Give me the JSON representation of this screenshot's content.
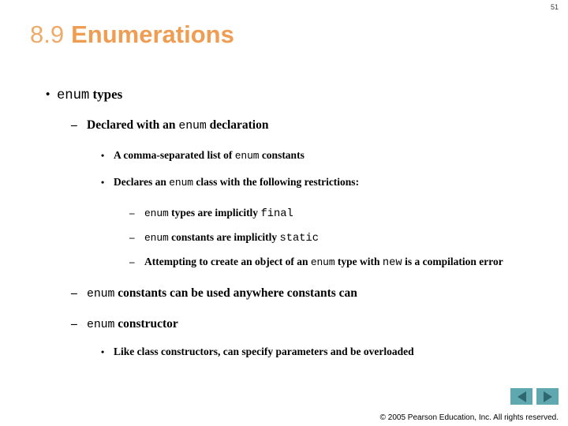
{
  "slide": {
    "page_number": "51",
    "title_number": "8.9",
    "title_text": "Enumerations",
    "title_color": "#ef9d52",
    "title_number_color": "#eeab6b"
  },
  "outline": {
    "b1": {
      "bullet": "•",
      "code1": "enum",
      "t1": " types"
    },
    "b2": {
      "bullet": "–",
      "t1": "Declared with an ",
      "code1": "enum",
      "t2": " declaration"
    },
    "b3": {
      "bullet": "•",
      "t1": "A comma-separated list of ",
      "code1": "enum",
      "t2": " constants"
    },
    "b4": {
      "bullet": "•",
      "t1": "Declares an ",
      "code1": "enum",
      "t2": " class with the following restrictions:"
    },
    "b5": {
      "bullet": "–",
      "code1": "enum",
      "t1": " types are implicitly ",
      "code2": "final"
    },
    "b6": {
      "bullet": "–",
      "code1": "enum",
      "t1": " constants are implicitly ",
      "code2": "static"
    },
    "b7": {
      "bullet": "–",
      "t1": "Attempting to create an object of an ",
      "code1": "enum",
      "t2": " type with ",
      "code2": "new",
      "t3": " is a compilation error"
    },
    "b8": {
      "bullet": "–",
      "code1": "enum",
      "t1": " constants can be used anywhere constants can"
    },
    "b9": {
      "bullet": "–",
      "code1": "enum",
      "t1": " constructor"
    },
    "b10": {
      "bullet": "•",
      "t1": "Like class constructors, can specify parameters and be overloaded"
    }
  },
  "nav": {
    "prev_icon": "triangle-left-icon",
    "next_icon": "triangle-right-icon",
    "button_color": "#5fa8b0",
    "arrow_color": "#2f6670"
  },
  "footer": {
    "copyright": "© 2005 Pearson Education, Inc.  All rights reserved."
  }
}
